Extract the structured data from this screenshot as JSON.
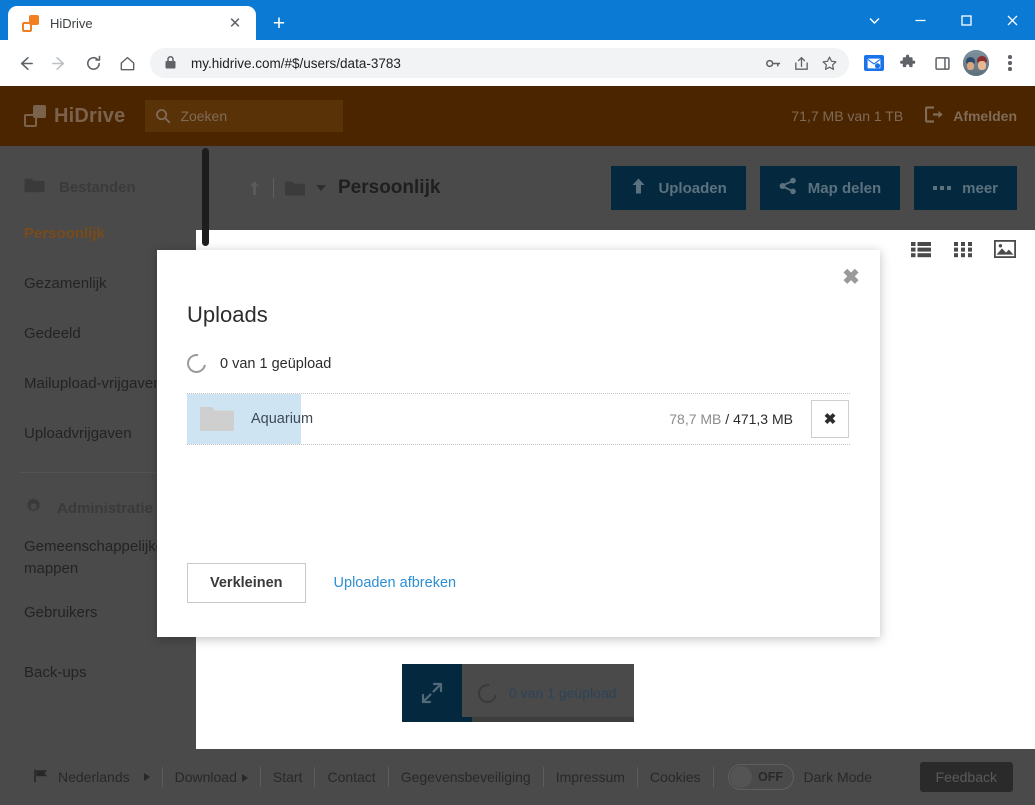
{
  "browser": {
    "tab": {
      "title": "HiDrive",
      "favicon": "hidrive-favicon",
      "close_label": "✕"
    },
    "new_tab_label": "+",
    "window_controls": [
      "tab-search-icon",
      "minimize-icon",
      "maximize-icon",
      "close-icon"
    ],
    "nav": {
      "back": "back-icon",
      "forward": "forward-icon",
      "reload": "reload-icon",
      "home": "home-icon"
    },
    "omnibox": {
      "url": "my.hidrive.com/#$/users/data-3783",
      "lock": "lock-icon",
      "actions": [
        "password-key-icon",
        "share-icon",
        "bookmark-star-icon"
      ]
    },
    "toolbar_right": [
      "mail-extension-icon",
      "extensions-puzzle-icon",
      "side-panel-icon",
      "profile-avatar",
      "chrome-menu-icon"
    ]
  },
  "app": {
    "header": {
      "brand": "HiDrive",
      "search_placeholder": "Zoeken",
      "quota": "71,7 MB van 1 TB",
      "logout_label": "Afmelden",
      "logout_icon": "logout-icon"
    },
    "breadcrumb": {
      "up_icon": "move-up-icon",
      "folder_icon": "folder-icon",
      "caret_icon": "chevron-down-icon",
      "current": "Persoonlijk"
    },
    "actions": [
      {
        "label": "Uploaden",
        "icon": "upload-arrow-icon"
      },
      {
        "label": "Map delen",
        "icon": "share-nodes-icon"
      },
      {
        "label": "meer",
        "icon": "ellipsis-icon"
      }
    ],
    "view_modes": [
      "list-view-icon",
      "grid-view-icon",
      "gallery-view-icon"
    ],
    "sidebar": {
      "sections": [
        {
          "heading": "Bestanden",
          "heading_icon": "folder-icon",
          "items": [
            {
              "label": "Persoonlijk",
              "active": true
            },
            {
              "label": "Gezamenlijk",
              "active": false
            },
            {
              "label": "Gedeeld",
              "active": false
            },
            {
              "label": "Mailupload-vrijgaven",
              "active": false
            },
            {
              "label": "Uploadvrijgaven",
              "active": false
            }
          ]
        },
        {
          "heading": "Administratie",
          "heading_icon": "gear-icon",
          "items": [
            {
              "label": "Gemeenschappelijke mappen",
              "active": false
            },
            {
              "label": "Gebruikers",
              "active": false
            },
            {
              "label": "Back-ups",
              "active": false
            }
          ]
        }
      ]
    },
    "upload_widget": {
      "expand_icon": "expand-arrows-icon",
      "spinner_icon": "spinner-icon",
      "status": "0 van 1 geüpload",
      "progress_percent": 16.7
    },
    "footer": {
      "language": "Nederlands",
      "language_icon": "flag-icon",
      "links": [
        "Download",
        "Start",
        "Contact",
        "Gegevensbeveiliging",
        "Impressum",
        "Cookies"
      ],
      "dark_mode": {
        "state": "OFF",
        "label": "Dark Mode"
      },
      "feedback": "Feedback"
    }
  },
  "modal": {
    "title": "Uploads",
    "close_icon": "close-icon",
    "spinner_icon": "spinner-icon",
    "status": "0 van 1 geüpload",
    "rows": [
      {
        "folder_icon": "folder-icon",
        "name": "Aquarium",
        "uploaded": "78,7 MB",
        "separator": " / ",
        "total": "471,3 MB",
        "cancel_icon": "close-icon",
        "progress_percent": 16.7
      }
    ],
    "buttons": {
      "minimize": "Verkleinen",
      "abort": "Uploaden afbreken"
    }
  },
  "colors": {
    "chrome_blue": "#0b7ad4",
    "brand_brown": "#4a2500",
    "accent_orange": "#f08020",
    "button_navy": "#04293f",
    "link_blue": "#2d8fd5",
    "progress_blue": "#cfe4f2",
    "overlay_gray": "#4a4a4a"
  }
}
